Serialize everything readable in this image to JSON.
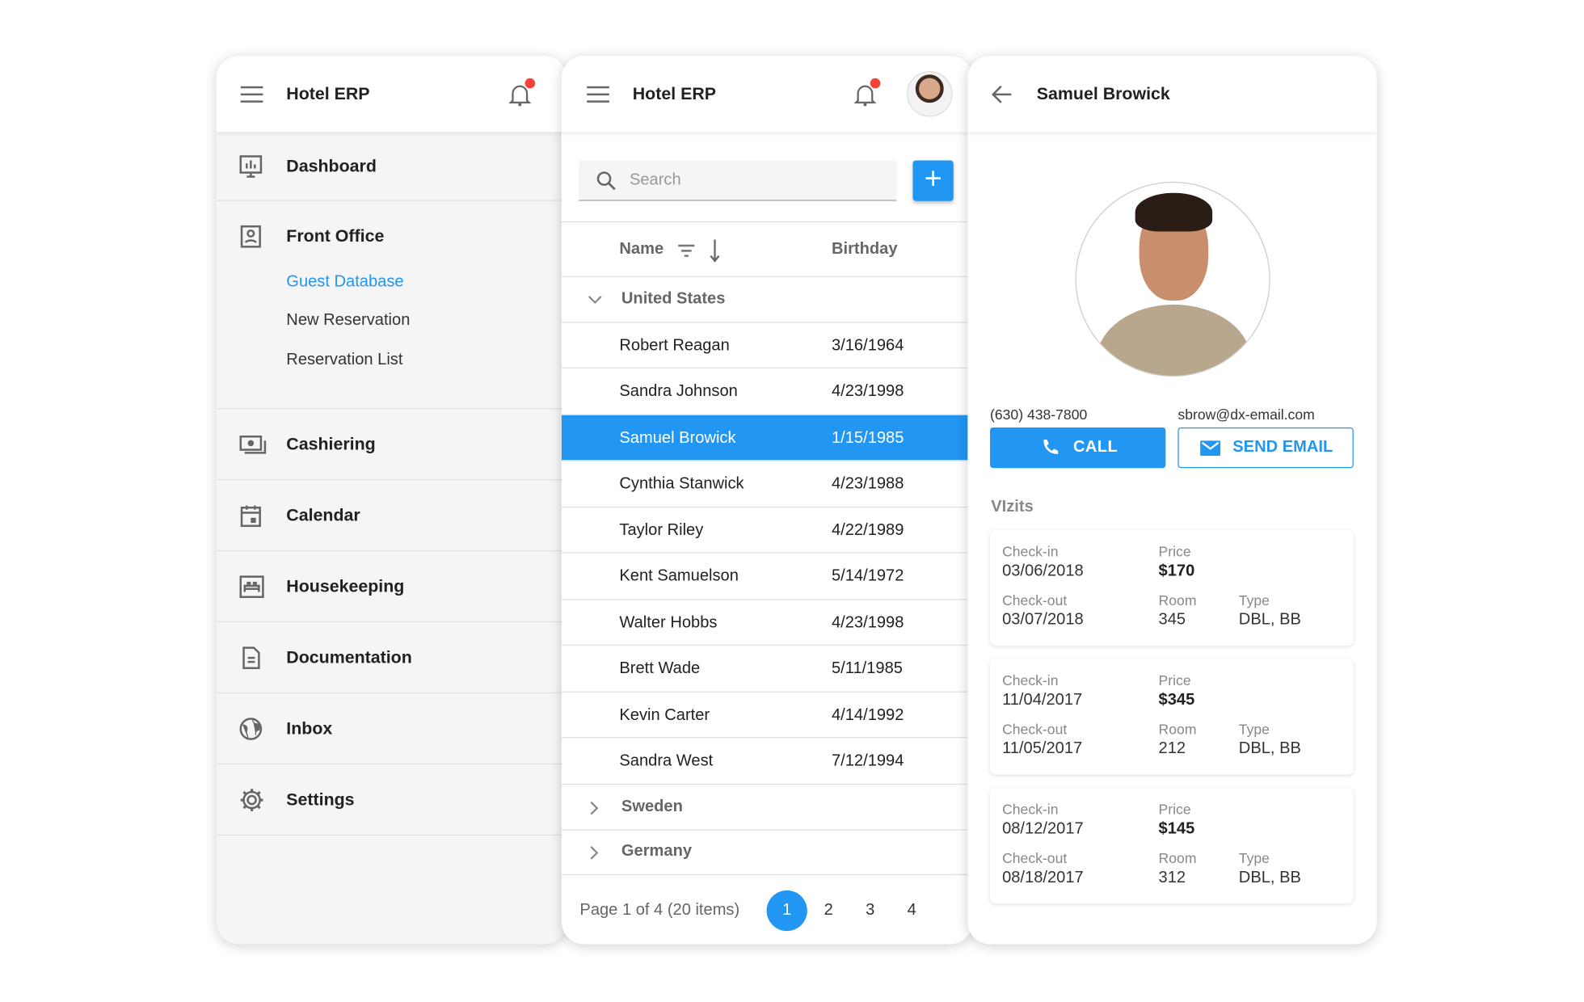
{
  "app_title": "Hotel ERP",
  "colors": {
    "accent": "#2196f3",
    "notification": "#f44336"
  },
  "nav": {
    "dashboard": "Dashboard",
    "front_office": "Front Office",
    "front_office_items": [
      "Guest Database",
      "New Reservation",
      "Reservation List"
    ],
    "active_item": "Guest Database",
    "cashiering": "Cashiering",
    "calendar": "Calendar",
    "housekeeping": "Housekeeping",
    "documentation": "Documentation",
    "inbox": "Inbox",
    "settings": "Settings"
  },
  "list": {
    "search_placeholder": "Search",
    "columns": {
      "name": "Name",
      "birthday": "Birthday"
    },
    "groups": [
      {
        "label": "United States",
        "expanded": true,
        "rows": [
          {
            "name": "Robert Reagan",
            "birthday": "3/16/1964"
          },
          {
            "name": "Sandra Johnson",
            "birthday": "4/23/1998"
          },
          {
            "name": "Samuel Browick",
            "birthday": "1/15/1985",
            "selected": true
          },
          {
            "name": "Cynthia Stanwick",
            "birthday": "4/23/1988"
          },
          {
            "name": "Taylor Riley",
            "birthday": "4/22/1989"
          },
          {
            "name": "Kent Samuelson",
            "birthday": "5/14/1972"
          },
          {
            "name": "Walter Hobbs",
            "birthday": "4/23/1998"
          },
          {
            "name": "Brett Wade",
            "birthday": "5/11/1985"
          },
          {
            "name": "Kevin Carter",
            "birthday": "4/14/1992"
          },
          {
            "name": "Sandra West",
            "birthday": "7/12/1994"
          }
        ]
      },
      {
        "label": "Sweden",
        "expanded": false
      },
      {
        "label": "Germany",
        "expanded": false
      }
    ],
    "pager": {
      "info": "Page 1 of 4 (20 items)",
      "pages": [
        "1",
        "2",
        "3",
        "4"
      ],
      "current": "1"
    }
  },
  "detail": {
    "title": "Samuel Browick",
    "phone": "(630) 438-7800",
    "email": "sbrow@dx-email.com",
    "call_label": "CALL",
    "email_label": "SEND EMAIL",
    "visits_title": "VIzits",
    "labels": {
      "checkin": "Check-in",
      "checkout": "Check-out",
      "price": "Price",
      "room": "Room",
      "type": "Type"
    },
    "visits": [
      {
        "checkin": "03/06/2018",
        "checkout": "03/07/2018",
        "price": "$170",
        "room": "345",
        "type": "DBL, BB"
      },
      {
        "checkin": "11/04/2017",
        "checkout": "11/05/2017",
        "price": "$345",
        "room": "212",
        "type": "DBL, BB"
      },
      {
        "checkin": "08/12/2017",
        "checkout": "08/18/2017",
        "price": "$145",
        "room": "312",
        "type": "DBL, BB"
      }
    ]
  }
}
